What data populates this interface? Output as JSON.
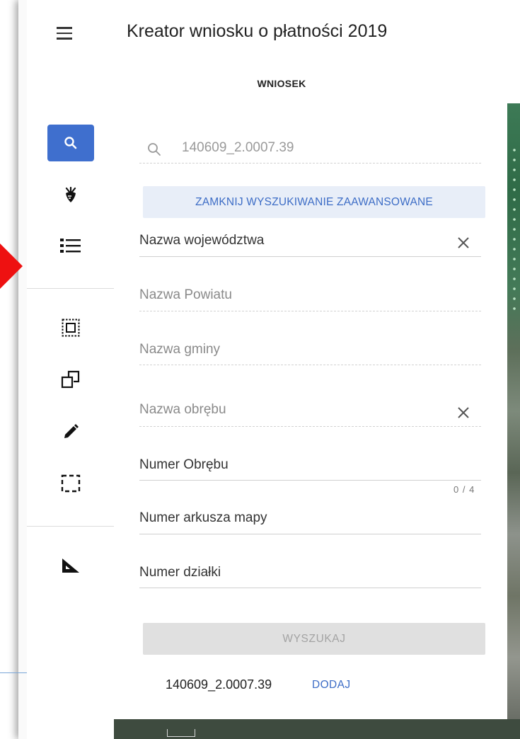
{
  "header": {
    "title": "Kreator wniosku o płatności 2019",
    "tab_label": "WNIOSEK"
  },
  "toolbar": {
    "buttons": [
      {
        "icon": "search-icon",
        "active": true
      },
      {
        "icon": "plant-icon"
      },
      {
        "icon": "list-icon"
      },
      {
        "icon": "select-region-icon"
      },
      {
        "icon": "copy-shape-icon"
      },
      {
        "icon": "pencil-icon"
      },
      {
        "icon": "dashed-rectangle-icon"
      },
      {
        "icon": "ruler-triangle-icon"
      }
    ]
  },
  "search": {
    "value": "140609_2.0007.39",
    "advanced_toggle_label": "ZAMKNIJ WYSZUKIWANIE ZAAWANSOWANE"
  },
  "fields": {
    "wojewodztwo": "Nazwa województwa",
    "powiat": "Nazwa Powiatu",
    "gmina": "Nazwa gminy",
    "obreb_name": "Nazwa obrębu",
    "obreb_number": "Numer Obrębu",
    "obreb_counter": "0 / 4",
    "arkusz": "Numer arkusza mapy",
    "dzialka": "Numer działki"
  },
  "actions": {
    "search_label": "WYSZUKAJ"
  },
  "result": {
    "id": "140609_2.0007.39",
    "add_label": "DODAJ"
  },
  "colors": {
    "accent": "#3f6fce",
    "link": "#3d6dc6",
    "advanced_button_bg": "#e8eef8",
    "disabled_button_bg": "#e0e0e0",
    "pointer_arrow": "#ee1111"
  }
}
